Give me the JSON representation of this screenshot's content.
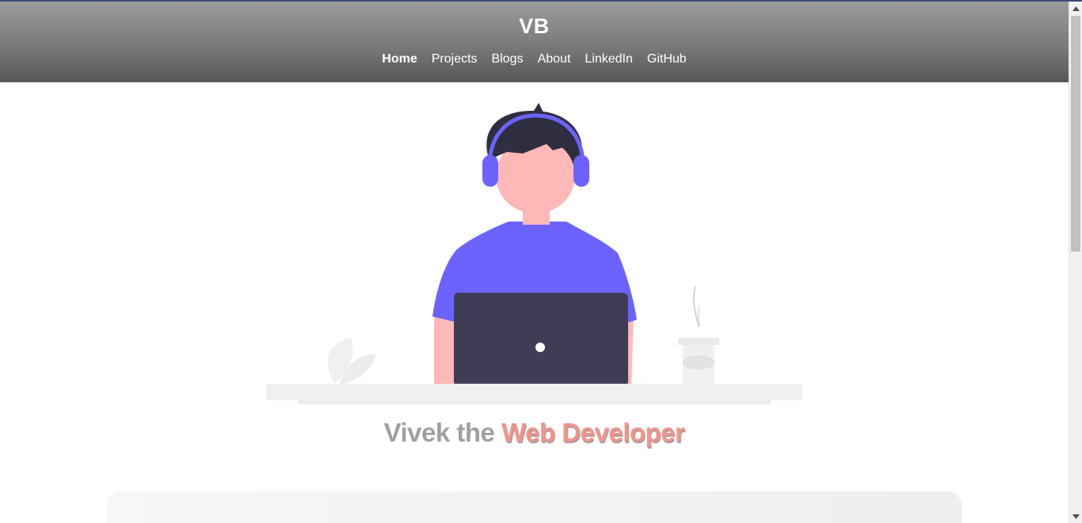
{
  "header": {
    "logo": "VB",
    "nav": [
      {
        "label": "Home",
        "active": true
      },
      {
        "label": "Projects",
        "active": false
      },
      {
        "label": "Blogs",
        "active": false
      },
      {
        "label": "About",
        "active": false
      },
      {
        "label": "LinkedIn",
        "active": false
      },
      {
        "label": "GitHub",
        "active": false
      }
    ]
  },
  "hero": {
    "illustration": "developer-with-headphones-at-laptop",
    "headline_prefix": "Vivek the",
    "headline_highlight": "Web Developer"
  },
  "colors": {
    "header_gradient_top": "#9b9b9b",
    "header_gradient_bottom": "#575757",
    "accent_purple": "#6c63ff",
    "laptop_dark": "#3f3d56",
    "skin": "#ffb8b8",
    "headline_grey": "#a0a0a0",
    "headline_accent": "#f0958c"
  }
}
